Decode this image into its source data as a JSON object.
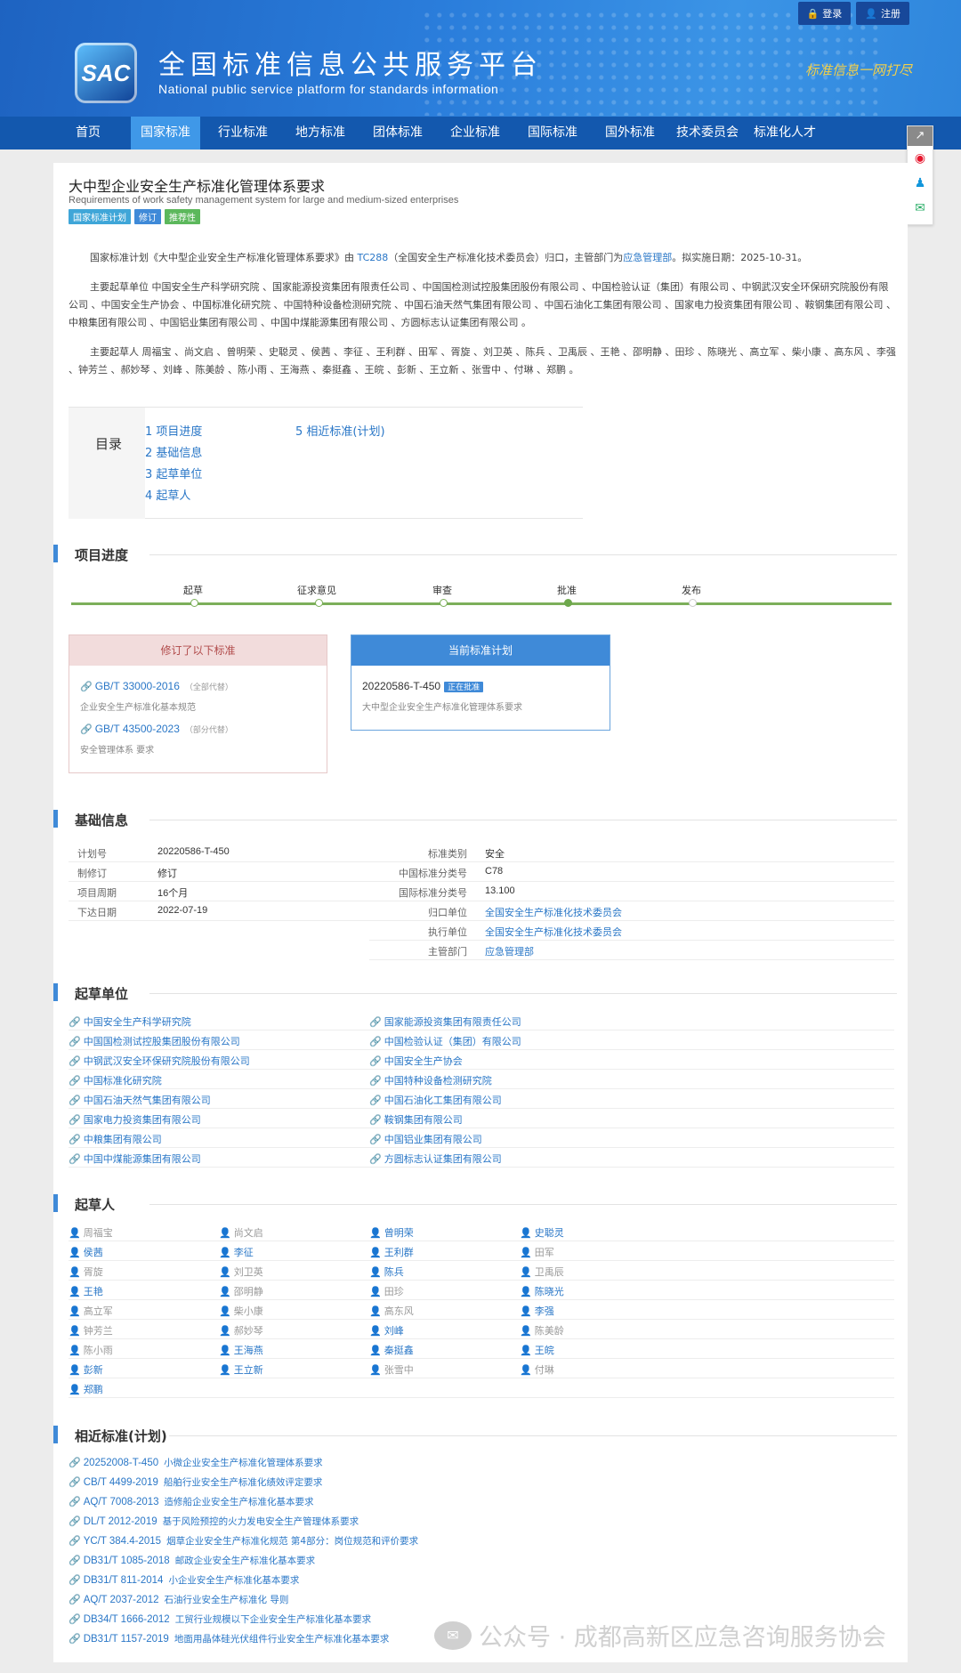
{
  "header": {
    "login": "登录",
    "register": "注册",
    "logo_text": "SAC",
    "site_cn": "全国标准信息公共服务平台",
    "site_en": "National public service platform  for standards information",
    "slogan": "标准信息一网打尽"
  },
  "nav": [
    "首页",
    "国家标准",
    "行业标准",
    "地方标准",
    "团体标准",
    "企业标准",
    "国际标准",
    "国外标准",
    "技术委员会",
    "标准化人才"
  ],
  "page": {
    "title": "大中型企业安全生产标准化管理体系要求",
    "subtitle": "Requirements of work safety management system for large and medium-sized enterprises",
    "tags": [
      {
        "text": "国家标准计划",
        "color": "#3fa6d8"
      },
      {
        "text": "修订",
        "color": "#3f8ad8"
      },
      {
        "text": "推荐性",
        "color": "#5cb85c"
      }
    ],
    "intro": {
      "p1_a": "国家标准计划《大中型企业安全生产标准化管理体系要求》由 ",
      "tc": "TC288",
      "p1_b": "（全国安全生产标准化技术委员会）归口，主管部门为",
      "dept": "应急管理部",
      "p1_c": "。拟实施日期：2025-10-31。",
      "p2": "主要起草单位 中国安全生产科学研究院 、国家能源投资集团有限责任公司 、中国国检测试控股集团股份有限公司 、中国检验认证（集团）有限公司 、中钢武汉安全环保研究院股份有限公司 、中国安全生产协会 、中国标准化研究院 、中国特种设备检测研究院 、中国石油天然气集团有限公司 、中国石油化工集团有限公司 、国家电力投资集团有限公司 、鞍钢集团有限公司 、中粮集团有限公司 、中国铝业集团有限公司 、中国中煤能源集团有限公司 、方圆标志认证集团有限公司 。",
      "p3": "主要起草人 周福宝 、尚文启 、曾明荣 、史聪灵 、侯茜 、李征 、王利群 、田军 、胥旋 、刘卫英 、陈兵 、卫禹辰 、王艳 、邵明静 、田珍 、陈晓光 、高立军 、柴小康 、高东风 、李强 、钟芳兰 、郝妙琴 、刘峰 、陈美龄 、陈小雨 、王海燕 、秦挺鑫 、王皖 、彭新 、王立新 、张雪中 、付琳 、郑鹏 。"
    }
  },
  "toc": {
    "label": "目录",
    "items": [
      "1  项目进度",
      "2  基础信息",
      "3  起草单位",
      "4  起草人",
      "5  相近标准(计划)"
    ]
  },
  "sections": {
    "progress": "项目进度",
    "basic": "基础信息",
    "units": "起草单位",
    "drafters": "起草人",
    "related": "相近标准(计划)"
  },
  "progress": {
    "stages": [
      "起草",
      "征求意见",
      "审查",
      "批准",
      "发布"
    ],
    "current_index": 3
  },
  "revised": {
    "header": "修订了以下标准",
    "items": [
      {
        "code": "GB/T 33000-2016",
        "note": "（全部代替）",
        "name": "企业安全生产标准化基本规范"
      },
      {
        "code": "GB/T 43500-2023",
        "note": "（部分代替）",
        "name": "安全管理体系 要求"
      }
    ]
  },
  "current_plan": {
    "header": "当前标准计划",
    "code": "20220586-T-450",
    "status": "正在批准",
    "name": "大中型企业安全生产标准化管理体系要求"
  },
  "basic_info": {
    "left": [
      {
        "k": "计划号",
        "v": "20220586-T-450"
      },
      {
        "k": "制修订",
        "v": "修订"
      },
      {
        "k": "项目周期",
        "v": "16个月"
      },
      {
        "k": "下达日期",
        "v": "2022-07-19"
      }
    ],
    "right": [
      {
        "k": "标准类别",
        "v": "安全",
        "link": false
      },
      {
        "k": "中国标准分类号",
        "v": "C78",
        "link": false
      },
      {
        "k": "国际标准分类号",
        "v": "13.100",
        "link": false
      },
      {
        "k": "归口单位",
        "v": "全国安全生产标准化技术委员会",
        "link": true
      },
      {
        "k": "执行单位",
        "v": "全国安全生产标准化技术委员会",
        "link": true
      },
      {
        "k": "主管部门",
        "v": "应急管理部",
        "link": true
      }
    ]
  },
  "units": [
    "中国安全生产科学研究院",
    "国家能源投资集团有限责任公司",
    "中国国检测试控股集团股份有限公司",
    "中国检验认证（集团）有限公司",
    "中钢武汉安全环保研究院股份有限公司",
    "中国安全生产协会",
    "中国标准化研究院",
    "中国特种设备检测研究院",
    "中国石油天然气集团有限公司",
    "中国石油化工集团有限公司",
    "国家电力投资集团有限公司",
    "鞍钢集团有限公司",
    "中粮集团有限公司",
    "中国铝业集团有限公司",
    "中国中煤能源集团有限公司",
    "方圆标志认证集团有限公司"
  ],
  "drafters": [
    {
      "n": "周福宝",
      "a": false
    },
    {
      "n": "尚文启",
      "a": false
    },
    {
      "n": "曾明荣",
      "a": true
    },
    {
      "n": "史聪灵",
      "a": true
    },
    {
      "n": "侯茜",
      "a": true
    },
    {
      "n": "李征",
      "a": true
    },
    {
      "n": "王利群",
      "a": true
    },
    {
      "n": "田军",
      "a": false
    },
    {
      "n": "胥旋",
      "a": false
    },
    {
      "n": "刘卫英",
      "a": false
    },
    {
      "n": "陈兵",
      "a": true
    },
    {
      "n": "卫禹辰",
      "a": false
    },
    {
      "n": "王艳",
      "a": true
    },
    {
      "n": "邵明静",
      "a": false
    },
    {
      "n": "田珍",
      "a": false
    },
    {
      "n": "陈晓光",
      "a": true
    },
    {
      "n": "高立军",
      "a": false
    },
    {
      "n": "柴小康",
      "a": false
    },
    {
      "n": "高东风",
      "a": false
    },
    {
      "n": "李强",
      "a": true
    },
    {
      "n": "钟芳兰",
      "a": false
    },
    {
      "n": "郝妙琴",
      "a": false
    },
    {
      "n": "刘峰",
      "a": true
    },
    {
      "n": "陈美龄",
      "a": false
    },
    {
      "n": "陈小雨",
      "a": false
    },
    {
      "n": "王海燕",
      "a": true
    },
    {
      "n": "秦挺鑫",
      "a": true
    },
    {
      "n": "王皖",
      "a": true
    },
    {
      "n": "彭新",
      "a": true
    },
    {
      "n": "王立新",
      "a": true
    },
    {
      "n": "张雪中",
      "a": false
    },
    {
      "n": "付琳",
      "a": false
    },
    {
      "n": "郑鹏",
      "a": true
    }
  ],
  "related": [
    {
      "code": "20252008-T-450",
      "name": "小微企业安全生产标准化管理体系要求"
    },
    {
      "code": "CB/T 4499-2019",
      "name": "船舶行业安全生产标准化绩效评定要求"
    },
    {
      "code": "AQ/T 7008-2013",
      "name": "造修船企业安全生产标准化基本要求"
    },
    {
      "code": "DL/T 2012-2019",
      "name": "基于风险预控的火力发电安全生产管理体系要求"
    },
    {
      "code": "YC/T 384.4-2015",
      "name": "烟草企业安全生产标准化规范 第4部分：岗位规范和评价要求"
    },
    {
      "code": "DB31/T 1085-2018",
      "name": "邮政企业安全生产标准化基本要求"
    },
    {
      "code": "DB31/T 811-2014",
      "name": "小企业安全生产标准化基本要求"
    },
    {
      "code": "AQ/T 2037-2012",
      "name": "石油行业安全生产标准化 导则"
    },
    {
      "code": "DB34/T 1666-2012",
      "name": "工贸行业规模以下企业安全生产标准化基本要求"
    },
    {
      "code": "DB31/T 1157-2019",
      "name": "地面用晶体硅光伏组件行业安全生产标准化基本要求"
    }
  ],
  "watermark": "公众号 · 成都高新区应急咨询服务协会",
  "colors": {
    "primary": "#1358ae",
    "accent": "#3f8ad8",
    "link": "#2a77c7",
    "progress": "#7caf5a"
  }
}
